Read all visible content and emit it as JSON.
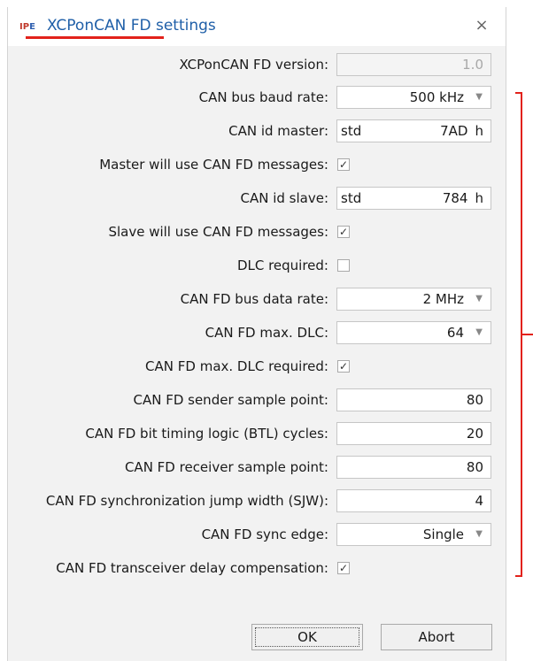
{
  "window": {
    "app_icon_text": "IP",
    "app_icon_accent": "E",
    "title": "XCPonCAN FD settings",
    "close_glyph": "×"
  },
  "fields": {
    "version": {
      "label": "XCPonCAN FD version:",
      "value": "1.0"
    },
    "baud_rate": {
      "label": "CAN bus baud rate:",
      "value": "500 kHz",
      "arrow": "▼"
    },
    "id_master": {
      "label": "CAN id master:",
      "type": "std",
      "value": "7AD",
      "unit": "h"
    },
    "master_fd": {
      "label": "Master will use CAN FD messages:",
      "checked": true
    },
    "id_slave": {
      "label": "CAN id slave:",
      "type": "std",
      "value": "784",
      "unit": "h"
    },
    "slave_fd": {
      "label": "Slave will use CAN FD messages:",
      "checked": true
    },
    "dlc_required": {
      "label": "DLC required:",
      "checked": false
    },
    "data_rate": {
      "label": "CAN FD bus data rate:",
      "value": "2 MHz",
      "arrow": "▼"
    },
    "max_dlc": {
      "label": "CAN FD max. DLC:",
      "value": "64",
      "arrow": "▼"
    },
    "max_dlc_required": {
      "label": "CAN FD max. DLC required:",
      "checked": true
    },
    "sender_sample_point": {
      "label": "CAN FD sender sample point:",
      "value": "80"
    },
    "btl_cycles": {
      "label": "CAN FD bit timing logic (BTL) cycles:",
      "value": "20"
    },
    "receiver_sample_point": {
      "label": "CAN FD receiver sample point:",
      "value": "80"
    },
    "sjw": {
      "label": "CAN FD synchronization jump width (SJW):",
      "value": "4"
    },
    "sync_edge": {
      "label": "CAN FD sync edge:",
      "value": "Single",
      "arrow": "▼"
    },
    "delay_comp": {
      "label": "CAN FD transceiver delay compensation:",
      "checked": true
    }
  },
  "check_glyph": "✓",
  "buttons": {
    "ok": "OK",
    "abort": "Abort"
  },
  "colors": {
    "annotation": "#e2221b",
    "title": "#1f5fa8"
  }
}
